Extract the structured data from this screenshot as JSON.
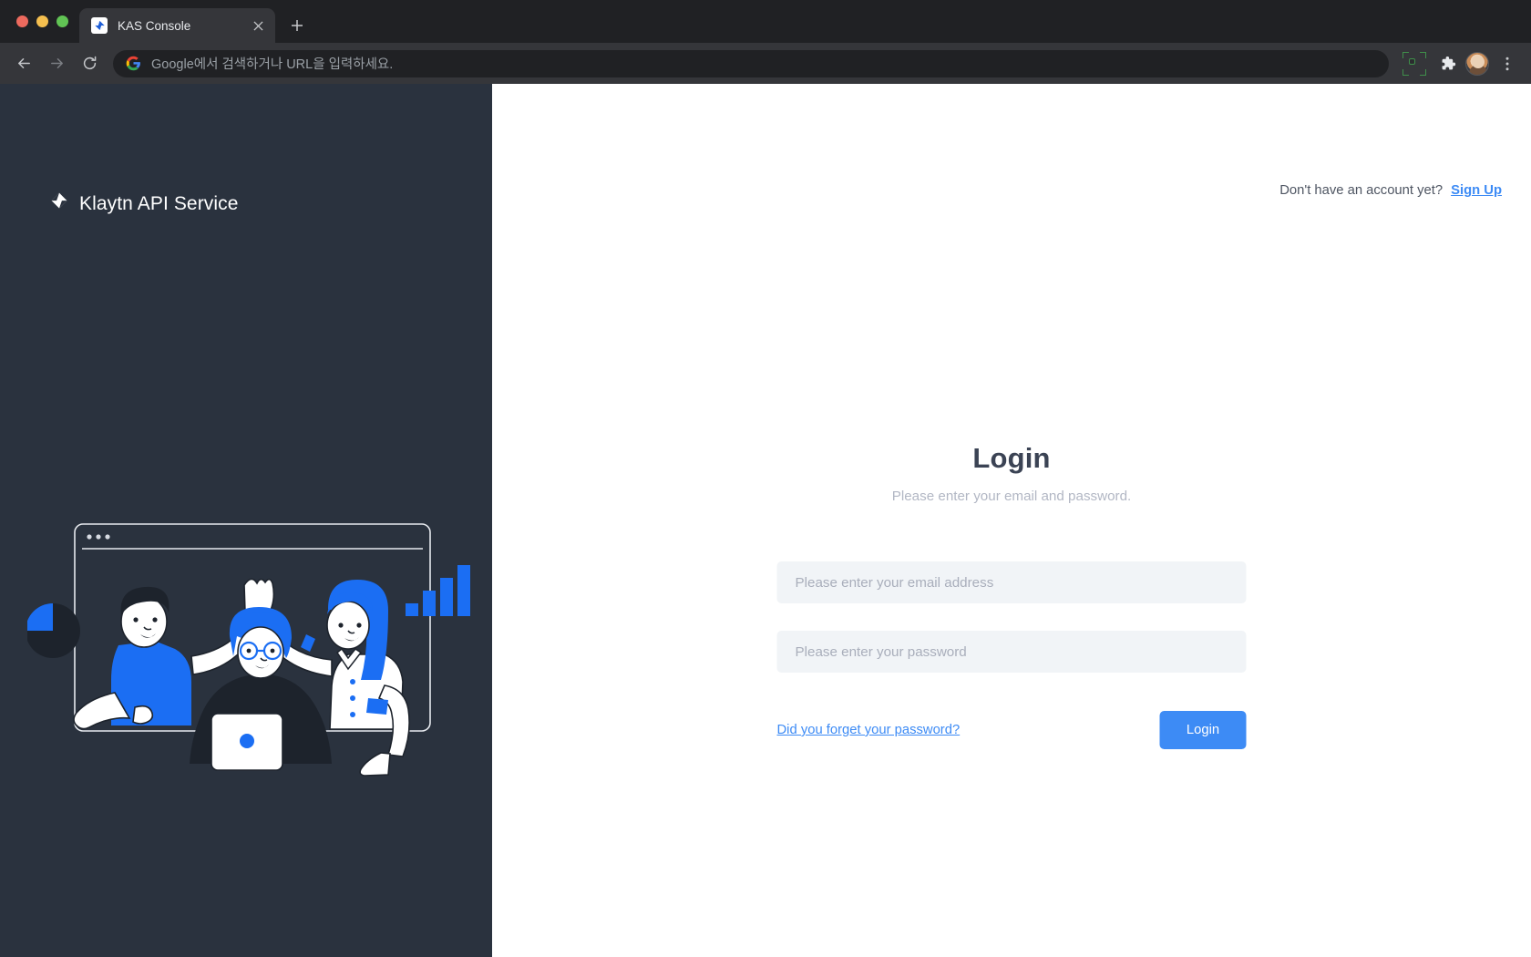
{
  "browser": {
    "tab": {
      "title": "KAS Console",
      "favicon_icon": "klaytn-logo-icon",
      "close_icon": "close-icon"
    },
    "new_tab_icon": "plus-icon",
    "back_icon": "arrow-left-icon",
    "forward_icon": "arrow-right-icon",
    "reload_icon": "reload-icon",
    "omnibox": {
      "placeholder": "Google에서 검색하거나 URL을 입력하세요.",
      "search_engine_icon": "google-icon"
    },
    "cast_icon": "cast-icon",
    "extensions_icon": "puzzle-piece-icon",
    "profile_icon": "avatar-icon",
    "menu_icon": "three-dots-vertical-icon"
  },
  "sidebar": {
    "brand_name": "Klaytn API Service",
    "brand_icon": "klaytn-logo-icon",
    "illustration": "team-highfive-illustration",
    "bg_color": "#2a323e"
  },
  "header": {
    "account_prompt": "Don't have an account yet?",
    "signup_label": "Sign Up"
  },
  "login": {
    "title": "Login",
    "subtitle": "Please enter your email and password.",
    "email": {
      "placeholder": "Please enter your email address",
      "value": ""
    },
    "password": {
      "placeholder": "Please enter your password",
      "value": ""
    },
    "forgot_label": "Did you forget your password?",
    "submit_label": "Login",
    "accent_color": "#3d8bf5"
  }
}
